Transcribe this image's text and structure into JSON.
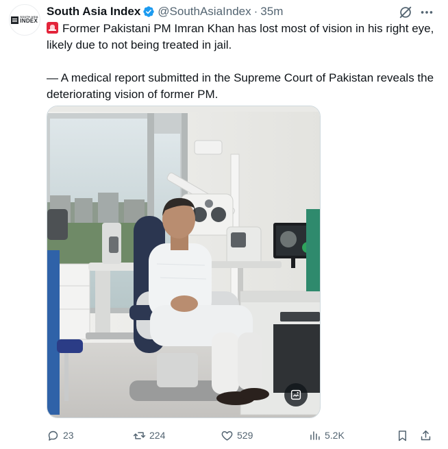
{
  "tweet": {
    "author": {
      "avatar_logo_small": "SOUTH ASIA",
      "avatar_logo_big": "INDEX",
      "display_name": "South Asia Index",
      "handle": "@SouthAsiaIndex",
      "separator": "·",
      "timestamp": "35m",
      "verified": true
    },
    "text": {
      "line1": "Former Pakistani PM Imran Khan has lost most of vision in his right eye, likely due to not being treated in jail.",
      "line2": "— A medical report submitted in the Supreme Court of Pakistan reveals the deteriorating vision of former PM."
    },
    "icons": {
      "emoji": "rotating-light-icon",
      "verified": "verified-badge-icon",
      "grok": "grok-icon",
      "more": "more-icon",
      "alt": "image-description-icon"
    },
    "metrics": {
      "replies": "23",
      "reposts": "224",
      "likes": "529",
      "views": "5.2K"
    },
    "colors": {
      "text": "#0f1419",
      "secondary": "#536471",
      "verified": "#1d9bf0",
      "emoji": "#e3243a"
    }
  }
}
